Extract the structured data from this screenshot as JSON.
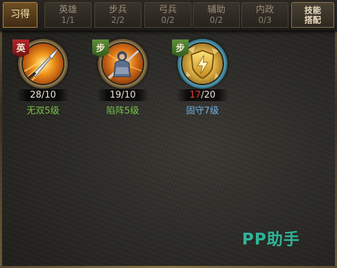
{
  "tabs": [
    {
      "name": "习得",
      "count": "",
      "active": true
    },
    {
      "name": "英雄",
      "count": "1/1"
    },
    {
      "name": "步兵",
      "count": "2/2"
    },
    {
      "name": "弓兵",
      "count": "0/2"
    },
    {
      "name": "辅助",
      "count": "0/2"
    },
    {
      "name": "内政",
      "count": "0/3"
    },
    {
      "name": "技能\n搭配",
      "count": ""
    }
  ],
  "skills": [
    {
      "badge": "英",
      "icon": "spear-thrust-icon",
      "progress_current": "28",
      "progress_total": "/10",
      "name": "无双5级"
    },
    {
      "badge": "步",
      "icon": "warrior-icon",
      "progress_current": "19",
      "progress_total": "/10",
      "name": "陷阵5级"
    },
    {
      "badge": "步",
      "icon": "lightning-shield-icon",
      "progress_current": "17",
      "progress_total": "/20",
      "name": "固守7级"
    }
  ],
  "watermark": "PP助手",
  "colors": {
    "tab_active": "#6e4f24",
    "badge_hero": "#b3282a",
    "badge_infantry": "#5f8f3a",
    "text_green": "#79c04a",
    "text_blue": "#6fb3e6",
    "progress_short": "#e8352e"
  }
}
